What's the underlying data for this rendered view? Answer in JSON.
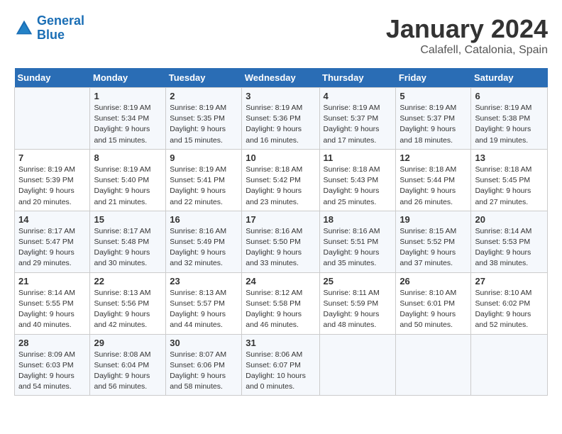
{
  "logo": {
    "line1": "General",
    "line2": "Blue"
  },
  "title": "January 2024",
  "subtitle": "Calafell, Catalonia, Spain",
  "header_days": [
    "Sunday",
    "Monday",
    "Tuesday",
    "Wednesday",
    "Thursday",
    "Friday",
    "Saturday"
  ],
  "weeks": [
    [
      {
        "day": "",
        "info": ""
      },
      {
        "day": "1",
        "info": "Sunrise: 8:19 AM\nSunset: 5:34 PM\nDaylight: 9 hours\nand 15 minutes."
      },
      {
        "day": "2",
        "info": "Sunrise: 8:19 AM\nSunset: 5:35 PM\nDaylight: 9 hours\nand 15 minutes."
      },
      {
        "day": "3",
        "info": "Sunrise: 8:19 AM\nSunset: 5:36 PM\nDaylight: 9 hours\nand 16 minutes."
      },
      {
        "day": "4",
        "info": "Sunrise: 8:19 AM\nSunset: 5:37 PM\nDaylight: 9 hours\nand 17 minutes."
      },
      {
        "day": "5",
        "info": "Sunrise: 8:19 AM\nSunset: 5:37 PM\nDaylight: 9 hours\nand 18 minutes."
      },
      {
        "day": "6",
        "info": "Sunrise: 8:19 AM\nSunset: 5:38 PM\nDaylight: 9 hours\nand 19 minutes."
      }
    ],
    [
      {
        "day": "7",
        "info": "Sunrise: 8:19 AM\nSunset: 5:39 PM\nDaylight: 9 hours\nand 20 minutes."
      },
      {
        "day": "8",
        "info": "Sunrise: 8:19 AM\nSunset: 5:40 PM\nDaylight: 9 hours\nand 21 minutes."
      },
      {
        "day": "9",
        "info": "Sunrise: 8:19 AM\nSunset: 5:41 PM\nDaylight: 9 hours\nand 22 minutes."
      },
      {
        "day": "10",
        "info": "Sunrise: 8:18 AM\nSunset: 5:42 PM\nDaylight: 9 hours\nand 23 minutes."
      },
      {
        "day": "11",
        "info": "Sunrise: 8:18 AM\nSunset: 5:43 PM\nDaylight: 9 hours\nand 25 minutes."
      },
      {
        "day": "12",
        "info": "Sunrise: 8:18 AM\nSunset: 5:44 PM\nDaylight: 9 hours\nand 26 minutes."
      },
      {
        "day": "13",
        "info": "Sunrise: 8:18 AM\nSunset: 5:45 PM\nDaylight: 9 hours\nand 27 minutes."
      }
    ],
    [
      {
        "day": "14",
        "info": "Sunrise: 8:17 AM\nSunset: 5:47 PM\nDaylight: 9 hours\nand 29 minutes."
      },
      {
        "day": "15",
        "info": "Sunrise: 8:17 AM\nSunset: 5:48 PM\nDaylight: 9 hours\nand 30 minutes."
      },
      {
        "day": "16",
        "info": "Sunrise: 8:16 AM\nSunset: 5:49 PM\nDaylight: 9 hours\nand 32 minutes."
      },
      {
        "day": "17",
        "info": "Sunrise: 8:16 AM\nSunset: 5:50 PM\nDaylight: 9 hours\nand 33 minutes."
      },
      {
        "day": "18",
        "info": "Sunrise: 8:16 AM\nSunset: 5:51 PM\nDaylight: 9 hours\nand 35 minutes."
      },
      {
        "day": "19",
        "info": "Sunrise: 8:15 AM\nSunset: 5:52 PM\nDaylight: 9 hours\nand 37 minutes."
      },
      {
        "day": "20",
        "info": "Sunrise: 8:14 AM\nSunset: 5:53 PM\nDaylight: 9 hours\nand 38 minutes."
      }
    ],
    [
      {
        "day": "21",
        "info": "Sunrise: 8:14 AM\nSunset: 5:55 PM\nDaylight: 9 hours\nand 40 minutes."
      },
      {
        "day": "22",
        "info": "Sunrise: 8:13 AM\nSunset: 5:56 PM\nDaylight: 9 hours\nand 42 minutes."
      },
      {
        "day": "23",
        "info": "Sunrise: 8:13 AM\nSunset: 5:57 PM\nDaylight: 9 hours\nand 44 minutes."
      },
      {
        "day": "24",
        "info": "Sunrise: 8:12 AM\nSunset: 5:58 PM\nDaylight: 9 hours\nand 46 minutes."
      },
      {
        "day": "25",
        "info": "Sunrise: 8:11 AM\nSunset: 5:59 PM\nDaylight: 9 hours\nand 48 minutes."
      },
      {
        "day": "26",
        "info": "Sunrise: 8:10 AM\nSunset: 6:01 PM\nDaylight: 9 hours\nand 50 minutes."
      },
      {
        "day": "27",
        "info": "Sunrise: 8:10 AM\nSunset: 6:02 PM\nDaylight: 9 hours\nand 52 minutes."
      }
    ],
    [
      {
        "day": "28",
        "info": "Sunrise: 8:09 AM\nSunset: 6:03 PM\nDaylight: 9 hours\nand 54 minutes."
      },
      {
        "day": "29",
        "info": "Sunrise: 8:08 AM\nSunset: 6:04 PM\nDaylight: 9 hours\nand 56 minutes."
      },
      {
        "day": "30",
        "info": "Sunrise: 8:07 AM\nSunset: 6:06 PM\nDaylight: 9 hours\nand 58 minutes."
      },
      {
        "day": "31",
        "info": "Sunrise: 8:06 AM\nSunset: 6:07 PM\nDaylight: 10 hours\nand 0 minutes."
      },
      {
        "day": "",
        "info": ""
      },
      {
        "day": "",
        "info": ""
      },
      {
        "day": "",
        "info": ""
      }
    ]
  ]
}
